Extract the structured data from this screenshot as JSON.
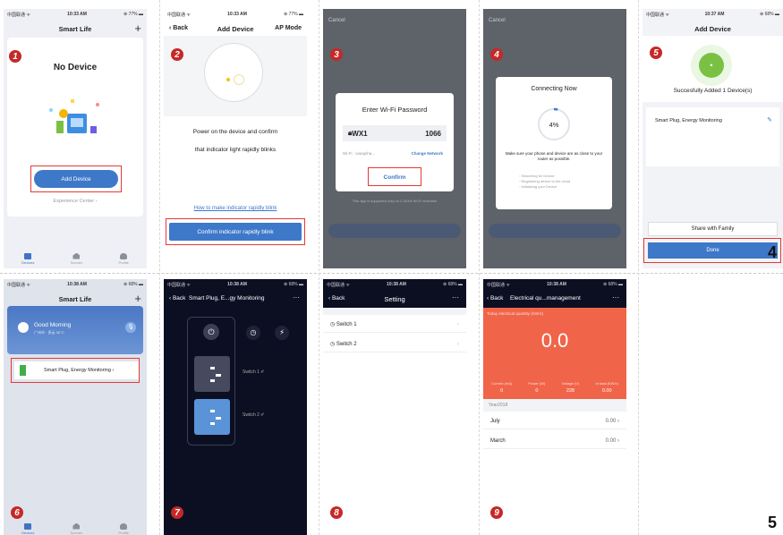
{
  "phones": {
    "p1": {
      "status": {
        "carrier": "中国联通 ᯤ",
        "time": "10:33 AM",
        "battery": "⊕ 77% ▬"
      },
      "title": "Smart Life",
      "plus": "+",
      "step": "1",
      "no_device": "No Device",
      "add_device": "Add Device",
      "experience": "Experience Center ›",
      "tabs": [
        "Devices",
        "Scenes",
        "Profile"
      ]
    },
    "p2": {
      "status": {
        "carrier": "中国联通 ᯤ",
        "time": "10:33 AM",
        "battery": "⊕ 77% ▬"
      },
      "back": "‹ Back",
      "title": "Add Device",
      "ap_mode": "AP Mode",
      "step": "2",
      "line1": "Power on the device and confirm",
      "line2": "that indicator light rapidly blinks",
      "link": "How to make indicator rapidly blink",
      "confirm_btn": "Confirm indicator rapidly blink"
    },
    "p3": {
      "cancel": "Cancel",
      "step": "3",
      "dialog_title": "Enter Wi-Fi Password",
      "ssid": "WX1",
      "password": "1066",
      "wifi_label": "Wi-Fi : xiangsha...",
      "change_network": "Change Network",
      "confirm": "Confirm",
      "note": "This app is supported only on 2.4GHz Wi-Fi channels"
    },
    "p4": {
      "cancel": "Cancel",
      "step": "4",
      "title": "Connecting Now",
      "percent": "4%",
      "progress": 0.04,
      "hint": "Make sure your phone and device are as close to your router as possible.",
      "steps": [
        "Searching for Device",
        "Registering device to the cloud",
        "Initializing your Device"
      ]
    },
    "p5": {
      "status": {
        "carrier": "中国联通 ᯤ",
        "time": "10:37 AM",
        "battery": "⊕ 68% ▬"
      },
      "title": "Add Device",
      "step": "5",
      "success": "Succesfully Added 1 Device(s)",
      "device": "Smart Plug, Energy Monitoring",
      "share": "Share with Family",
      "done": "Done"
    },
    "p6": {
      "status": {
        "carrier": "中国联通 ᯤ",
        "time": "10:38 AM",
        "battery": "⊕ 68% ▬"
      },
      "title": "Smart Life",
      "plus": "+",
      "step": "6",
      "greeting": "Good Morning",
      "weather": "广州市 · 多云 30°C",
      "device": "Smart Plug, Energy Monitoring ›",
      "tabs": [
        "Devices",
        "Scenes",
        "Profile"
      ]
    },
    "p7": {
      "status": {
        "carrier": "中国联通 ᯤ",
        "time": "10:38 AM",
        "battery": "⊕ 68% ▬"
      },
      "back": "‹ Back",
      "title": "Smart Plug, E...gy Monitoring",
      "more": "···",
      "step": "7",
      "switch1": "Switch 1 ✐",
      "switch2": "Switch 2 ✐"
    },
    "p8": {
      "status": {
        "carrier": "中国联通 ᯤ",
        "time": "10:38 AM",
        "battery": "⊕ 68% ▬"
      },
      "back": "‹ Back",
      "title": "Setting",
      "more": "···",
      "step": "8",
      "items": [
        "Switch 1",
        "Switch 2"
      ]
    },
    "p9": {
      "status": {
        "carrier": "中国联通 ᯤ",
        "time": "10:38 AM",
        "battery": "⊕ 68% ▬"
      },
      "back": "‹ Back",
      "title": "Electrical qu...management",
      "more": "···",
      "step": "9",
      "today": "Today electrical quantity (KW.h)",
      "total": "0.0",
      "metrics": [
        {
          "label": "Current (mA)",
          "value": "0"
        },
        {
          "label": "Power (W)",
          "value": "0"
        },
        {
          "label": "Voltage (V)",
          "value": "228"
        },
        {
          "label": "In total (KW.h)",
          "value": "0.00"
        }
      ],
      "year": "Year2018",
      "months": [
        {
          "name": "July",
          "value": "0.00 ›"
        },
        {
          "name": "March",
          "value": "0.00 ›"
        }
      ]
    }
  },
  "page_numbers": {
    "row1": "4",
    "row2": "5"
  },
  "colors": {
    "accent": "#3e78c9",
    "step": "#c62828",
    "highlight": "#e53935",
    "energy": "#f06449",
    "dark": "#0c0f22"
  }
}
